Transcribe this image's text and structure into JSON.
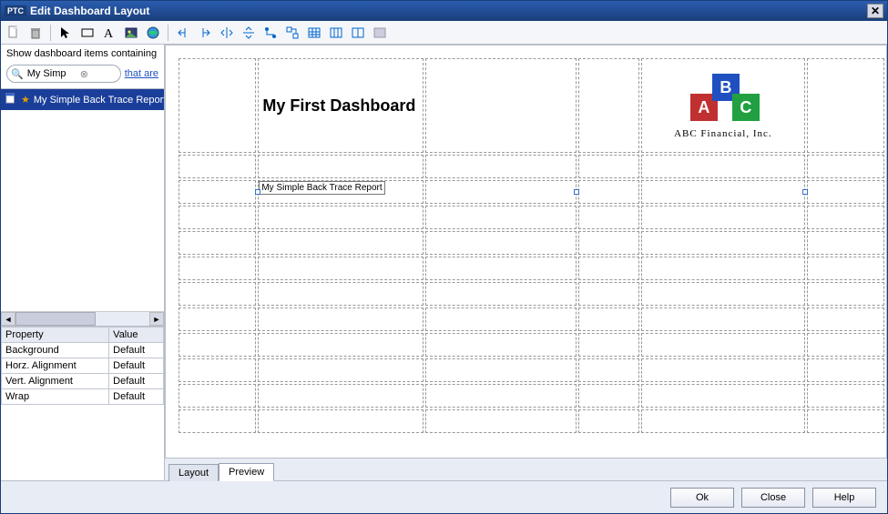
{
  "window": {
    "title": "Edit Dashboard Layout",
    "brand": "PTC"
  },
  "toolbar": {
    "icons": [
      "new-doc",
      "delete",
      "pointer",
      "rect",
      "text-A",
      "image",
      "globe",
      "merge-left",
      "merge-right",
      "split-h",
      "split-v",
      "node",
      "group",
      "table",
      "grid3",
      "grid2",
      "fill"
    ]
  },
  "filter": {
    "label": "Show dashboard items containing",
    "search_value": "My Simp",
    "thatare": "that are"
  },
  "tree": {
    "items": [
      {
        "label": "My Simple Back Trace Report",
        "starred": true
      }
    ]
  },
  "properties": {
    "header1": "Property",
    "header2": "Value",
    "rows": [
      {
        "name": "Background",
        "value": "Default"
      },
      {
        "name": "Horz. Alignment",
        "value": "Default"
      },
      {
        "name": "Vert. Alignment",
        "value": "Default"
      },
      {
        "name": "Wrap",
        "value": "Default"
      }
    ]
  },
  "dashboard": {
    "title": "My First Dashboard",
    "logo": {
      "letters": [
        "A",
        "B",
        "C"
      ],
      "company": "ABC Financial, Inc."
    },
    "selected_cell_label": "My Simple Back Trace Report"
  },
  "tabs": {
    "layout": "Layout",
    "preview": "Preview",
    "active": "preview"
  },
  "footer": {
    "ok": "Ok",
    "close": "Close",
    "help": "Help"
  }
}
